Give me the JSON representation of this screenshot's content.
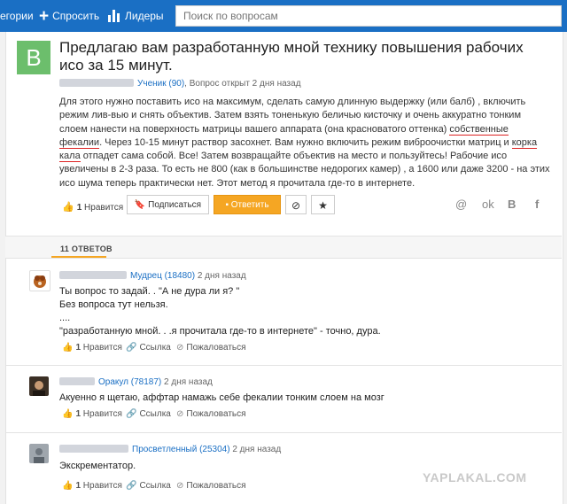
{
  "topbar": {
    "categories": "егории",
    "ask": "Спросить",
    "leaders": "Лидеры",
    "search_placeholder": "Поиск по вопросам"
  },
  "question": {
    "avatar_letter": "B",
    "title": "Предлагаю вам разработанную мной технику повышения рабочих исо за 15 минут.",
    "author_rank": "Ученик (90)",
    "opened": ", Вопрос открыт 2 дня назад",
    "body_1": "Для этого нужно поставить исо на максимум, сделать самую длинную выдержку (или балб) , включить режим лив-вью и снять объектив. Затем взять тоненькую беличью кисточку и очень аккуратно тонким слоем нанести на поверхность матрицы вашего аппарата (она красноватого оттенка) ",
    "body_red_1": "собственные фекалии",
    "body_2": ". Через 10-15 минут раствор засохнет. Вам нужно включить режим виброочистки матриц и ",
    "body_red_2": "корка кала",
    "body_3": " отпадет сама собой. Все! Затем возвращайте объектив на место и пользуйтесь! Рабочие исо увеличены в 2-3 раза. То есть не 800 (как в большинстве недорогих камер) , а 1600 или даже 3200 - на этих исо шума теперь практически нет. Этот метод я прочитала где-то в интернете.",
    "likes_count": "1",
    "likes_label": "Нравится",
    "subscribe": "Подписаться",
    "answer_btn": "Ответить",
    "share_icons": [
      "@",
      "ok",
      "B",
      "f"
    ]
  },
  "answers_header": "11 ОТВЕТОВ",
  "answers": [
    {
      "rank": "Мудрец (18480)",
      "time": "2 дня назад",
      "text": "Ты вопрос то задай. . \"А не дура ли я? \"\nБез вопроса тут нельзя.\n....\n\"разработанную мной. . .я прочитала где-то в интернете\" - точно, дура.",
      "likes": "1",
      "like_label": "Нравится",
      "link": "Ссылка",
      "complain": "Пожаловаться"
    },
    {
      "rank": "Оракул (78187)",
      "time": "2 дня назад",
      "text": "Акуенно я щетаю, аффтар намажь себе фекалии тонким слоем на мозг",
      "likes": "1",
      "like_label": "Нравится",
      "link": "Ссылка",
      "complain": "Пожаловаться"
    },
    {
      "rank": "Просветленный (25304)",
      "time": "2 дня назад",
      "text": "Экскрементатор.",
      "likes": "1",
      "like_label": "Нравится",
      "link": "Ссылка",
      "complain": "Пожаловаться"
    }
  ],
  "watermark": "YAPLAKAL.COM",
  "colors": {
    "topbar": "#1a6fc4",
    "orange": "#f5a623",
    "avatar_green": "#6cbe6c",
    "red_underline": "#dd2222"
  }
}
